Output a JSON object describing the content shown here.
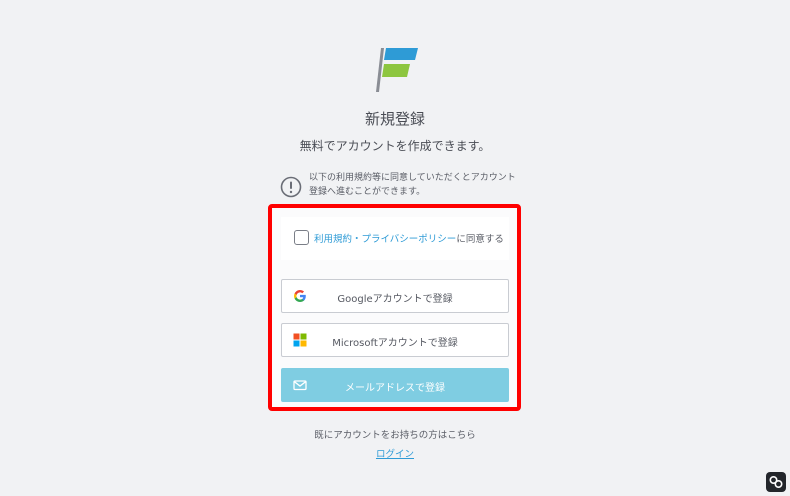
{
  "page": {
    "title": "新規登録",
    "subtitle": "無料でアカウントを作成できます。"
  },
  "logo": {
    "icon": "flag-logo-icon",
    "colors": [
      "#2e9bd6",
      "#8dc63f",
      "#8a8d94"
    ]
  },
  "notice": {
    "icon": "exclamation-circle-icon",
    "text": "以下の利用規約等に同意していただくとアカウント\n登録へ進むことができます。"
  },
  "agreement": {
    "link_label": "利用規約・プライバシーポリシー",
    "suffix": "に同意する",
    "checked": false
  },
  "buttons": {
    "google": {
      "label": "Googleアカウントで登録",
      "icon": "google-icon"
    },
    "microsoft": {
      "label": "Microsoftアカウントで登録",
      "icon": "microsoft-icon"
    },
    "email": {
      "label": "メールアドレスで登録",
      "icon": "mail-icon"
    }
  },
  "footer": {
    "have_account": "既にアカウントをお持ちの方はこちら",
    "login_label": "ログイン"
  },
  "colors": {
    "accent": "#2e9bd6",
    "email_button": "#7fcde2",
    "highlight_border": "#ff0000",
    "background": "#f1f2f4"
  }
}
